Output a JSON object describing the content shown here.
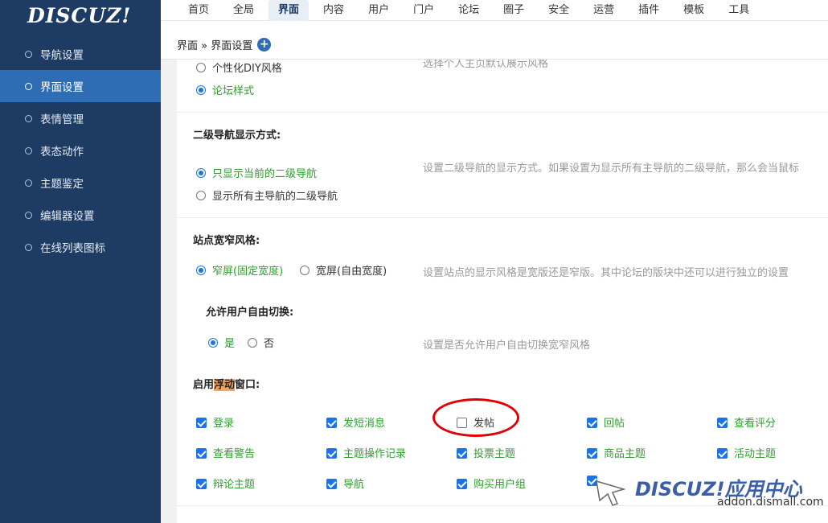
{
  "logo": "DISCUZ!",
  "sidebar": {
    "items": [
      {
        "label": "导航设置",
        "active": false
      },
      {
        "label": "界面设置",
        "active": true
      },
      {
        "label": "表情管理",
        "active": false
      },
      {
        "label": "表态动作",
        "active": false
      },
      {
        "label": "主题鉴定",
        "active": false
      },
      {
        "label": "编辑器设置",
        "active": false
      },
      {
        "label": "在线列表图标",
        "active": false
      }
    ]
  },
  "topnav": {
    "items": [
      {
        "label": "首页",
        "active": false
      },
      {
        "label": "全局",
        "active": false
      },
      {
        "label": "界面",
        "active": true
      },
      {
        "label": "内容",
        "active": false
      },
      {
        "label": "用户",
        "active": false
      },
      {
        "label": "门户",
        "active": false
      },
      {
        "label": "论坛",
        "active": false
      },
      {
        "label": "圈子",
        "active": false
      },
      {
        "label": "安全",
        "active": false
      },
      {
        "label": "运营",
        "active": false
      },
      {
        "label": "插件",
        "active": false
      },
      {
        "label": "模板",
        "active": false
      },
      {
        "label": "工具",
        "active": false
      }
    ]
  },
  "breadcrumb": {
    "text": "界面 » 界面设置",
    "plus": "+"
  },
  "sections": {
    "home_style": {
      "options": [
        "个性化DIY风格",
        "论坛样式"
      ],
      "selected": 1,
      "hint": "选择个人主页默认展示风格"
    },
    "subnav": {
      "title": "二级导航显示方式:",
      "options": [
        "只显示当前的二级导航",
        "显示所有主导航的二级导航"
      ],
      "selected": 0,
      "hint": "设置二级导航的显示方式。如果设置为显示所有主导航的二级导航，那么会当鼠标"
    },
    "width": {
      "title": "站点宽窄风格:",
      "options": [
        "窄屏(固定宽度)",
        "宽屏(自由宽度)"
      ],
      "selected": 0,
      "hint": "设置站点的显示风格是宽版还是窄版。其中论坛的版块中还可以进行独立的设置"
    },
    "switch": {
      "title": "允许用户自由切换:",
      "options": [
        "是",
        "否"
      ],
      "selected": 0,
      "hint": "设置是否允许用户自由切换宽窄风格"
    },
    "floatwin": {
      "title_pre": "启用",
      "title_hl": "浮动",
      "title_post": "窗口:",
      "items": [
        {
          "label": "登录",
          "checked": true
        },
        {
          "label": "发短消息",
          "checked": true
        },
        {
          "label": "发帖",
          "checked": false
        },
        {
          "label": "回帖",
          "checked": true
        },
        {
          "label": "查看评分",
          "checked": true
        },
        {
          "label": "查看警告",
          "checked": true
        },
        {
          "label": "主题操作记录",
          "checked": true
        },
        {
          "label": "投票主题",
          "checked": true
        },
        {
          "label": "商品主题",
          "checked": true
        },
        {
          "label": "活动主题",
          "checked": true
        },
        {
          "label": "辩论主题",
          "checked": true
        },
        {
          "label": "导航",
          "checked": true
        },
        {
          "label": "购买用户组",
          "checked": true
        },
        {
          "label": "",
          "checked": true
        }
      ]
    }
  },
  "watermark": {
    "brand": "DISCUZ!应用中心",
    "url": "addon.dismall.com"
  },
  "colors": {
    "sidebar": "#1d3b63",
    "active": "#2e6db3",
    "accent": "#1a73e8",
    "green": "#2d9f2d",
    "highlight_circle": "#e00000"
  }
}
